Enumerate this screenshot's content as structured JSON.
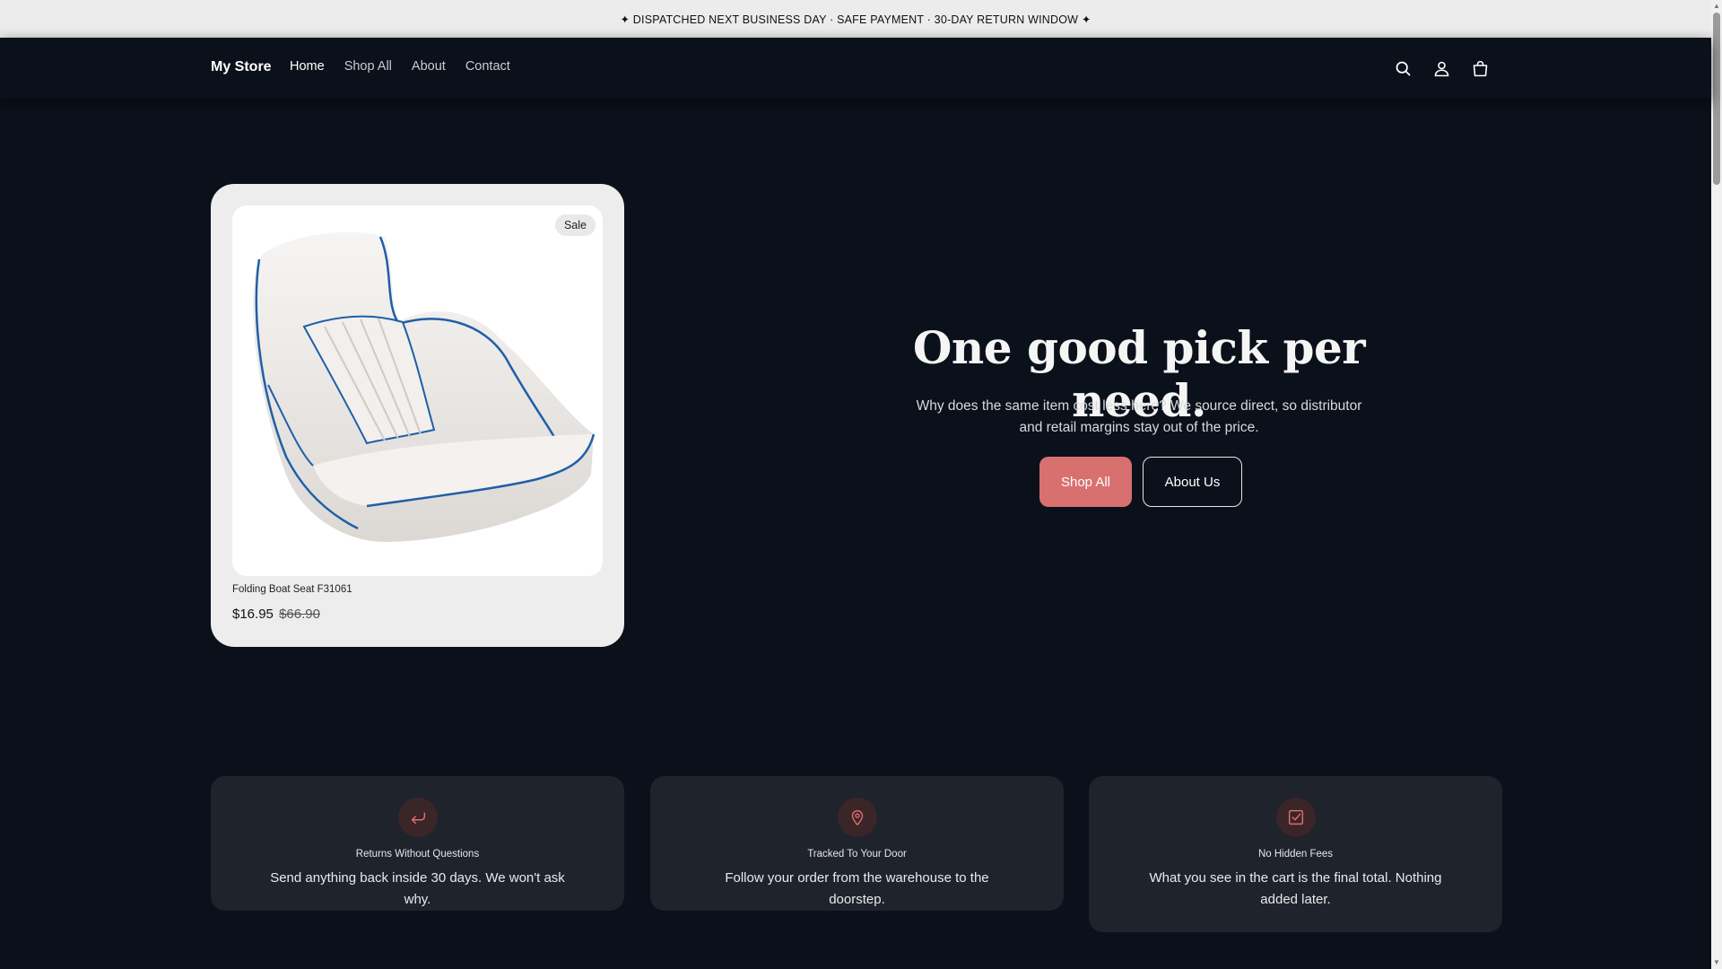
{
  "announcement": "✦ DISPATCHED NEXT BUSINESS DAY · SAFE PAYMENT · 30-DAY RETURN WINDOW ✦",
  "header": {
    "brand": "My Store",
    "nav": [
      "Home",
      "Shop All",
      "About",
      "Contact"
    ],
    "icons": [
      "search-icon",
      "account-icon",
      "cart-icon"
    ]
  },
  "product": {
    "badge": "Sale",
    "name": "Folding Boat Seat F31061",
    "price": "$16.95",
    "compare_price": "$66.90"
  },
  "hero": {
    "title": "One good pick per need.",
    "subtitle": "Why does the same item cost less here? We source direct, so distributor and retail margins stay out of the price.",
    "primary_button": "Shop All",
    "secondary_button": "About Us"
  },
  "features": [
    {
      "icon": "return-arrow-icon",
      "title": "Returns Without Questions",
      "text": "Send anything back inside 30 days. We won't ask why."
    },
    {
      "icon": "map-pin-icon",
      "title": "Tracked To Your Door",
      "text": "Follow your order from the warehouse to the doorstep."
    },
    {
      "icon": "checkbox-icon",
      "title": "No Hidden Fees",
      "text": "What you see in the cart is the final total. Nothing added later."
    }
  ],
  "colors": {
    "page_background": "#0b111a",
    "accent": "#d97070",
    "card_background": "#ededed",
    "feature_background": "#1f232c"
  }
}
